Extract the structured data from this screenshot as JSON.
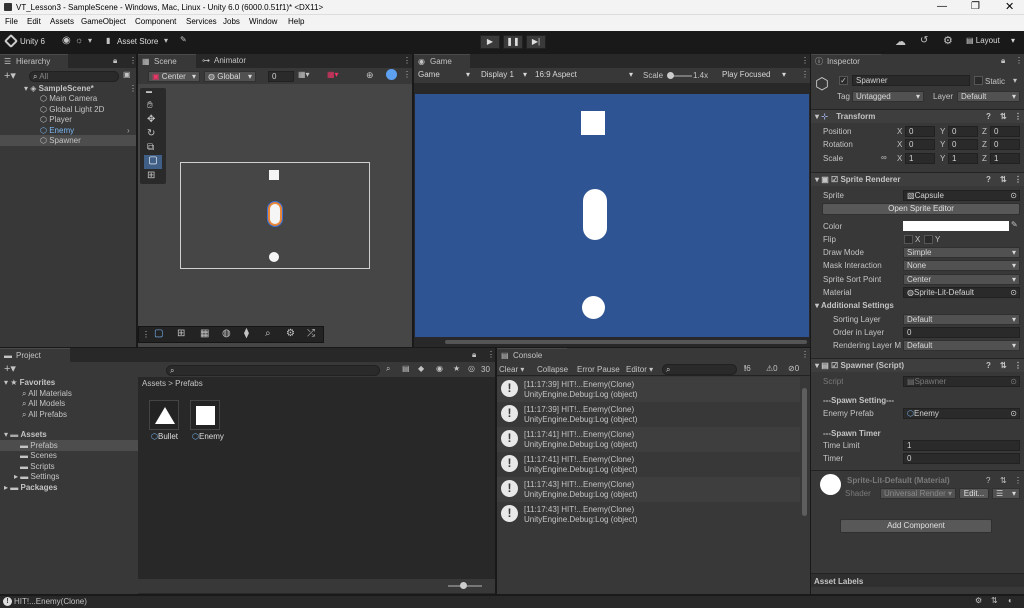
{
  "window": {
    "title": "VT_Lesson3 - SampleScene - Windows, Mac, Linux - Unity 6.0 (6000.0.51f1)* <DX11>"
  },
  "menu": [
    "File",
    "Edit",
    "Assets",
    "GameObject",
    "Component",
    "Services",
    "Jobs",
    "Window",
    "Help"
  ],
  "toolbar": {
    "account": "Unity 6",
    "asset_store": "Asset Store",
    "layout": "Layout"
  },
  "hierarchy": {
    "tab": "Hierarchy",
    "search_placeholder": "All",
    "scene": "SampleScene*",
    "items": [
      "Main Camera",
      "Global Light 2D",
      "Player",
      "Enemy",
      "Spawner"
    ]
  },
  "scene": {
    "tab": "Scene",
    "animator_tab": "Animator",
    "pivot": "Center",
    "space": "Global",
    "snap": "0"
  },
  "game": {
    "tab": "Game",
    "mode": "Game",
    "display": "Display 1",
    "aspect": "16:9 Aspect",
    "scale_label": "Scale",
    "scale_value": "1.4x",
    "play_mode": "Play Focused",
    "bg_color": "#2f5493"
  },
  "project": {
    "tab": "Project",
    "count": "30",
    "favorites": "Favorites",
    "fav_items": [
      "All Materials",
      "All Models",
      "All Prefabs"
    ],
    "assets": "Assets",
    "asset_folders": [
      "Prefabs",
      "Scenes",
      "Scripts",
      "Settings"
    ],
    "packages": "Packages",
    "breadcrumb_root": "Assets",
    "breadcrumb_sep": ">",
    "breadcrumb_leaf": "Prefabs",
    "prefabs": [
      "Bullet",
      "Enemy"
    ]
  },
  "console": {
    "tab": "Console",
    "clear": "Clear",
    "collapse": "Collapse",
    "error_pause": "Error Pause",
    "editor": "Editor",
    "log_count": "6",
    "warn_count": "0",
    "err_count": "0",
    "entries": [
      {
        "line1": "[11:17:39] HIT!...Enemy(Clone)",
        "line2": "UnityEngine.Debug:Log (object)"
      },
      {
        "line1": "[11:17:39] HIT!...Enemy(Clone)",
        "line2": "UnityEngine.Debug:Log (object)"
      },
      {
        "line1": "[11:17:41] HIT!...Enemy(Clone)",
        "line2": "UnityEngine.Debug:Log (object)"
      },
      {
        "line1": "[11:17:41] HIT!...Enemy(Clone)",
        "line2": "UnityEngine.Debug:Log (object)"
      },
      {
        "line1": "[11:17:43] HIT!...Enemy(Clone)",
        "line2": "UnityEngine.Debug:Log (object)"
      },
      {
        "line1": "[11:17:43] HIT!...Enemy(Clone)",
        "line2": "UnityEngine.Debug:Log (object)"
      }
    ]
  },
  "inspector": {
    "tab": "Inspector",
    "object_name": "Spawner",
    "static_label": "Static",
    "tag_label": "Tag",
    "tag": "Untagged",
    "layer_label": "Layer",
    "layer": "Default",
    "transform": {
      "title": "Transform",
      "position_label": "Position",
      "rotation_label": "Rotation",
      "scale_label": "Scale",
      "axis_x": "X",
      "axis_y": "Y",
      "axis_z": "Z",
      "position": [
        "0",
        "0",
        "0"
      ],
      "rotation": [
        "0",
        "0",
        "0"
      ],
      "scale": [
        "1",
        "1",
        "1"
      ]
    },
    "sprite_renderer": {
      "title": "Sprite Renderer",
      "sprite_label": "Sprite",
      "sprite": "Capsule",
      "open_editor": "Open Sprite Editor",
      "color_label": "Color",
      "flip_label": "Flip",
      "flip_x": "X",
      "flip_y": "Y",
      "draw_mode_label": "Draw Mode",
      "draw_mode": "Simple",
      "mask_label": "Mask Interaction",
      "mask": "None",
      "sort_point_label": "Sprite Sort Point",
      "sort_point": "Center",
      "material_label": "Material",
      "material": "Sprite-Lit-Default",
      "additional": "Additional Settings",
      "sorting_layer_label": "Sorting Layer",
      "sorting_layer": "Default",
      "order_label": "Order in Layer",
      "order": "0",
      "rendering_layer_label": "Rendering Layer M",
      "rendering_layer": "Default"
    },
    "spawner_script": {
      "title": "Spawner (Script)",
      "script_label": "Script",
      "script": "Spawner",
      "header1": "---Spawn Setting---",
      "enemy_prefab_label": "Enemy Prefab",
      "enemy_prefab": "Enemy",
      "header2": "---Spawn Timer",
      "time_limit_label": "Time Limit",
      "time_limit": "1",
      "timer_label": "Timer",
      "timer": "0"
    },
    "material": {
      "name": "Sprite-Lit-Default (Material)",
      "shader_label": "Shader",
      "shader": "Universal Render",
      "edit": "Edit..."
    },
    "add_component": "Add Component",
    "asset_labels": "Asset Labels"
  },
  "status": {
    "message": "HIT!...Enemy(Clone)"
  }
}
